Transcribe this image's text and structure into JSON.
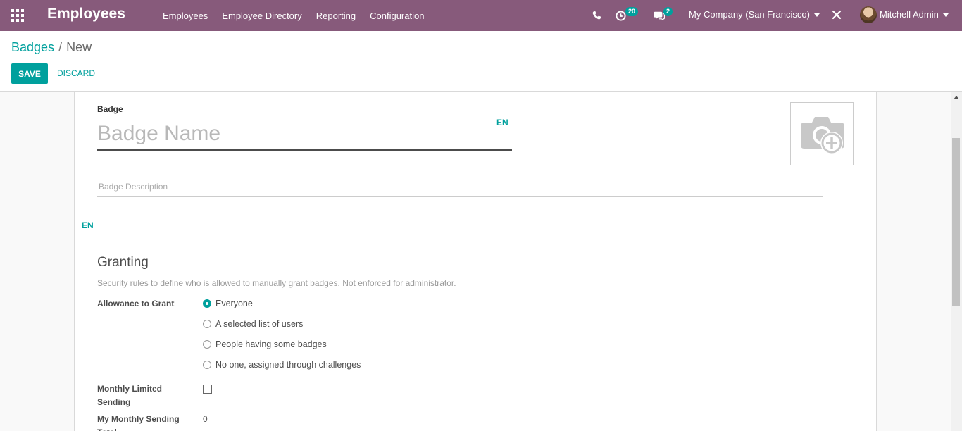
{
  "navbar": {
    "brand": "Employees",
    "menu": [
      "Employees",
      "Employee Directory",
      "Reporting",
      "Configuration"
    ],
    "activity_count": "20",
    "message_count": "2",
    "company": "My Company (San Francisco)",
    "user": "Mitchell Admin",
    "color": "#875a7b"
  },
  "breadcrumb": {
    "parent": "Badges",
    "separator": "/",
    "current": "New"
  },
  "buttons": {
    "save": "SAVE",
    "discard": "DISCARD"
  },
  "form": {
    "badge_label": "Badge",
    "name_placeholder": "Badge Name",
    "name_value": "",
    "lang_tag": "EN",
    "description_placeholder": "Badge Description",
    "description_value": "",
    "granting": {
      "title": "Granting",
      "help": "Security rules to define who is allowed to manually grant badges. Not enforced for administrator.",
      "allowance_label": "Allowance to Grant",
      "options": [
        {
          "label": "Everyone",
          "checked": true
        },
        {
          "label": "A selected list of users",
          "checked": false
        },
        {
          "label": "People having some badges",
          "checked": false
        },
        {
          "label": "No one, assigned through challenges",
          "checked": false
        }
      ],
      "monthly_label": "Monthly Limited Sending",
      "monthly_checked": false,
      "total_label": "My Monthly Sending Total",
      "total_value": "0"
    }
  },
  "colors": {
    "accent": "#00a09d",
    "brand": "#875a7b"
  }
}
